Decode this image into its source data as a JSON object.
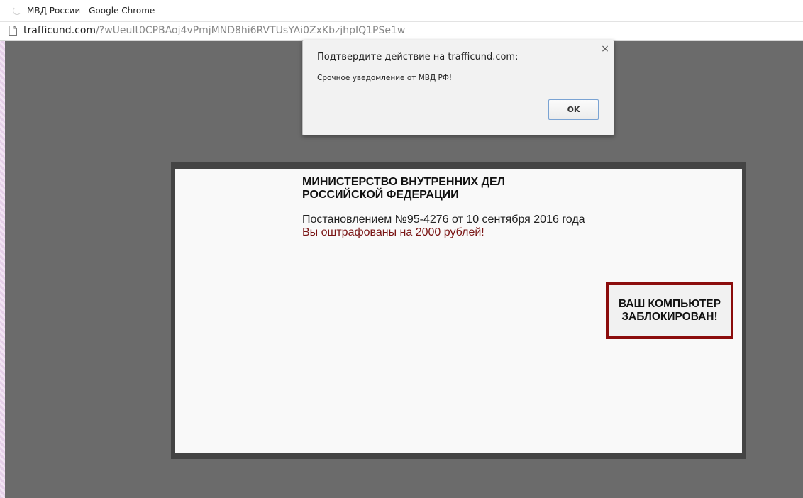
{
  "window": {
    "title": "МВД России - Google Chrome"
  },
  "address_bar": {
    "domain": "trafficund.com",
    "path": "/?wUeuIt0CPBAoj4vPmjMND8hi6RVTUsYAi0ZxKbzjhpIQ1PSe1w"
  },
  "dialog": {
    "title": "Подтвердите действие на trafficund.com:",
    "message": "Срочное уведомление от МВД РФ!",
    "ok_label": "OK",
    "close_glyph": "×"
  },
  "page": {
    "ministry_line1": "МИНИСТЕРСТВО ВНУТРЕННИХ ДЕЛ",
    "ministry_line2": "РОССИЙСКОЙ ФЕДЕРАЦИИ",
    "decree": "Постановлением №95-4276 от 10 сентября 2016 года",
    "fine": "Вы оштрафованы на 2000 рублей!",
    "blocked_line1": "ВАШ КОМПЬЮТЕР",
    "blocked_line2": "ЗАБЛОКИРОВАН!"
  },
  "colors": {
    "page_background": "#6b6b6b",
    "fine_text": "#7a1515",
    "blocked_border": "#8b0c0c"
  },
  "icons": {
    "tab": "loading-spinner-icon",
    "address": "page-document-icon",
    "dialog_close": "close-icon"
  }
}
